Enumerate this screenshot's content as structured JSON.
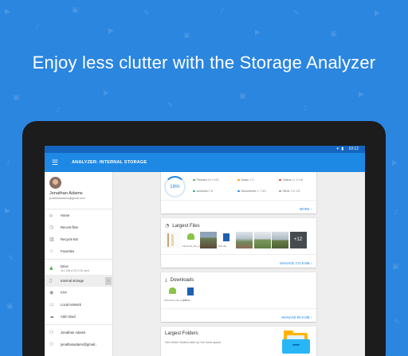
{
  "promo": {
    "headline": "Enjoy less clutter with the Storage Analyzer"
  },
  "status_bar": {
    "time": "10:12",
    "icons": "▾ ▮"
  },
  "app_bar": {
    "title": "ANALYZER: INTERNAL STORAGE",
    "menu_icon": "hamburger-menu-icon"
  },
  "drawer": {
    "user_name": "Jonathan Adams",
    "user_email": "jonathanadams@gmail.com",
    "items": [
      {
        "label": "Home",
        "icon": "home-icon"
      },
      {
        "label": "Recent files",
        "icon": "clock-icon"
      },
      {
        "label": "Recycle Bin",
        "icon": "trash-icon"
      },
      {
        "label": "Favorites",
        "icon": "star-icon"
      },
      {
        "label": "Drive",
        "sub": "46.1 MB of 30.0 GB used",
        "icon": "drive-icon"
      },
      {
        "label": "Internal storage",
        "icon": "phone-icon"
      },
      {
        "label": "FTP",
        "icon": "ftp-icon"
      },
      {
        "label": "Local network",
        "icon": "network-icon"
      },
      {
        "label": "Add cloud",
        "icon": "cloud-add-icon"
      },
      {
        "label": "Jonathan Adams",
        "icon": "account-icon"
      },
      {
        "label": "jonathanadams@gmail...",
        "icon": "account-icon"
      }
    ]
  },
  "storage_summary": {
    "percent": "16%",
    "legend": [
      {
        "label": "Pictures",
        "value": "69.9 MB",
        "color": "#4caf50"
      },
      {
        "label": "Music",
        "value": "0 B",
        "color": "#ff9800"
      },
      {
        "label": "Videos",
        "value": "11.8 MB",
        "color": "#e53935"
      },
      {
        "label": "Archives",
        "value": "0 B",
        "color": "#26a69a"
      },
      {
        "label": "Documents",
        "value": "4.7 MB",
        "color": "#1e88e5"
      },
      {
        "label": "Other",
        "value": "3.6 GB",
        "color": "#9e9e9e"
      }
    ],
    "more_label": "MORE"
  },
  "largest_files": {
    "title": "Largest Files",
    "files": [
      {
        "name": "Oflexbuilt_File_6_218..."
      },
      {
        "name": "Skill.dat"
      }
    ],
    "more_count": "+12",
    "manage_label": "MANAGE 273.9 MB"
  },
  "downloads": {
    "title": "Downloads",
    "files": [
      {
        "name": "Oflexbuilt_File_6_218..."
      },
      {
        "name": "Skill.dat"
      }
    ],
    "manage_label": "MANAGE 80.9 MB"
  },
  "largest_folders": {
    "title": "Largest Folders",
    "description": "See which folders take up the most space."
  }
}
